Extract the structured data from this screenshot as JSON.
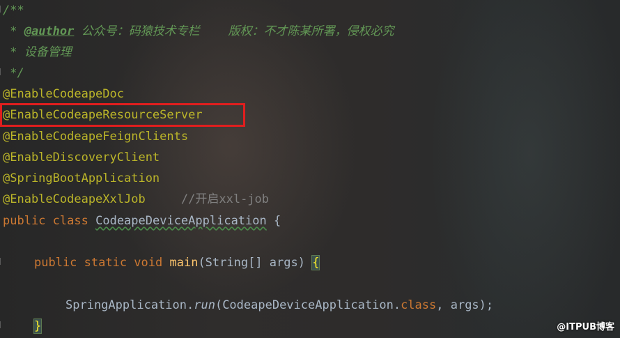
{
  "code": {
    "doc_open": "/**",
    "author_prefix": " * ",
    "author_tag": "@author",
    "author_text": " 公众号：码猿技术专栏    版权：不才陈某所署，侵权必究",
    "doc_desc": " * 设备管理",
    "doc_close": " */",
    "annotations": [
      "@EnableCodeapeDoc",
      "@EnableCodeapeResourceServer",
      "@EnableCodeapeFeignClients",
      "@EnableDiscoveryClient",
      "@SpringBootApplication",
      "@EnableCodeapeXxlJob"
    ],
    "xxl_comment": "//开启xxl-job",
    "class_kw1": "public",
    "class_kw2": "class",
    "class_name": "CodeapeDeviceApplication",
    "class_brace": " {",
    "main_kw": "public static void",
    "main_name": "main",
    "main_params": "(String[] args) ",
    "main_brace": "{",
    "run_prefix": "SpringApplication.",
    "run_method": "run",
    "run_args_open": "(CodeapeDeviceApplication.",
    "run_class_kw": "class",
    "run_args_close": ", args);",
    "close_brace": "}"
  },
  "highlight": {
    "color": "#e01e1e",
    "target": "@EnableCodeapeResourceServer"
  },
  "watermark": "@ITPUB博客"
}
